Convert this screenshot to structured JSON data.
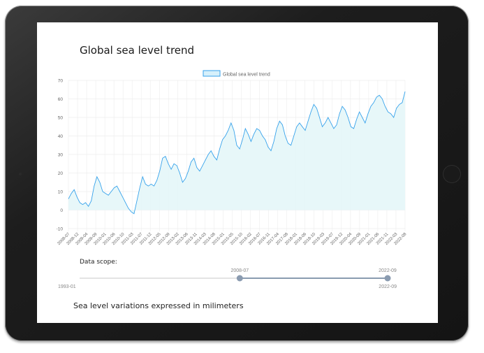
{
  "page": {
    "title": "Global sea level trend",
    "scope_label": "Data scope:",
    "caption": "Sea level variations expressed in milimeters"
  },
  "chart_data": {
    "type": "area",
    "legend": "Global sea level trend",
    "legend_position": "top-center",
    "ylim": [
      -10,
      70
    ],
    "y_ticks": [
      -10,
      0,
      10,
      20,
      30,
      40,
      50,
      60,
      70
    ],
    "grid": true,
    "color": "#36a2eb",
    "x_tick_labels": [
      "2008-07",
      "2008-12",
      "2009-04",
      "2009-09",
      "2010-01",
      "2010-06",
      "2010-10",
      "2011-03",
      "2011-07",
      "2011-12",
      "2012-05",
      "2012-09",
      "2013-02",
      "2013-06",
      "2013-11",
      "2014-03",
      "2014-08",
      "2015-01",
      "2015-05",
      "2015-10",
      "2016-02",
      "2016-07",
      "2016-11",
      "2017-04",
      "2017-08",
      "2018-01",
      "2018-06",
      "2018-10",
      "2019-03",
      "2019-07",
      "2019-12",
      "2020-04",
      "2020-09",
      "2021-01",
      "2021-06",
      "2021-11",
      "2022-03",
      "2022-08"
    ],
    "series": [
      {
        "name": "Global sea level trend",
        "values": [
          6,
          9,
          11,
          7,
          4,
          3,
          4,
          2,
          5,
          13,
          18,
          15,
          10,
          9,
          8,
          10,
          12,
          13,
          10,
          7,
          4,
          1,
          -1,
          -2,
          5,
          12,
          18,
          14,
          13,
          14,
          13,
          16,
          21,
          28,
          29,
          25,
          22,
          25,
          24,
          20,
          15,
          17,
          21,
          26,
          28,
          23,
          21,
          24,
          27,
          30,
          32,
          29,
          27,
          33,
          38,
          40,
          43,
          47,
          43,
          35,
          33,
          38,
          44,
          41,
          37,
          41,
          44,
          43,
          40,
          38,
          34,
          32,
          37,
          44,
          48,
          46,
          40,
          36,
          35,
          40,
          45,
          47,
          45,
          43,
          48,
          53,
          57,
          55,
          50,
          45,
          47,
          50,
          47,
          44,
          46,
          52,
          56,
          54,
          50,
          45,
          44,
          49,
          53,
          50,
          47,
          52,
          56,
          58,
          61,
          62,
          60,
          56,
          53,
          52,
          50,
          55,
          57,
          58,
          64
        ]
      }
    ]
  },
  "scope": {
    "min_label": "1993-01",
    "max_label": "2022-09",
    "start_label": "2008-07",
    "end_label": "2022-09",
    "start_fraction": 0.52,
    "end_fraction": 1.0
  }
}
